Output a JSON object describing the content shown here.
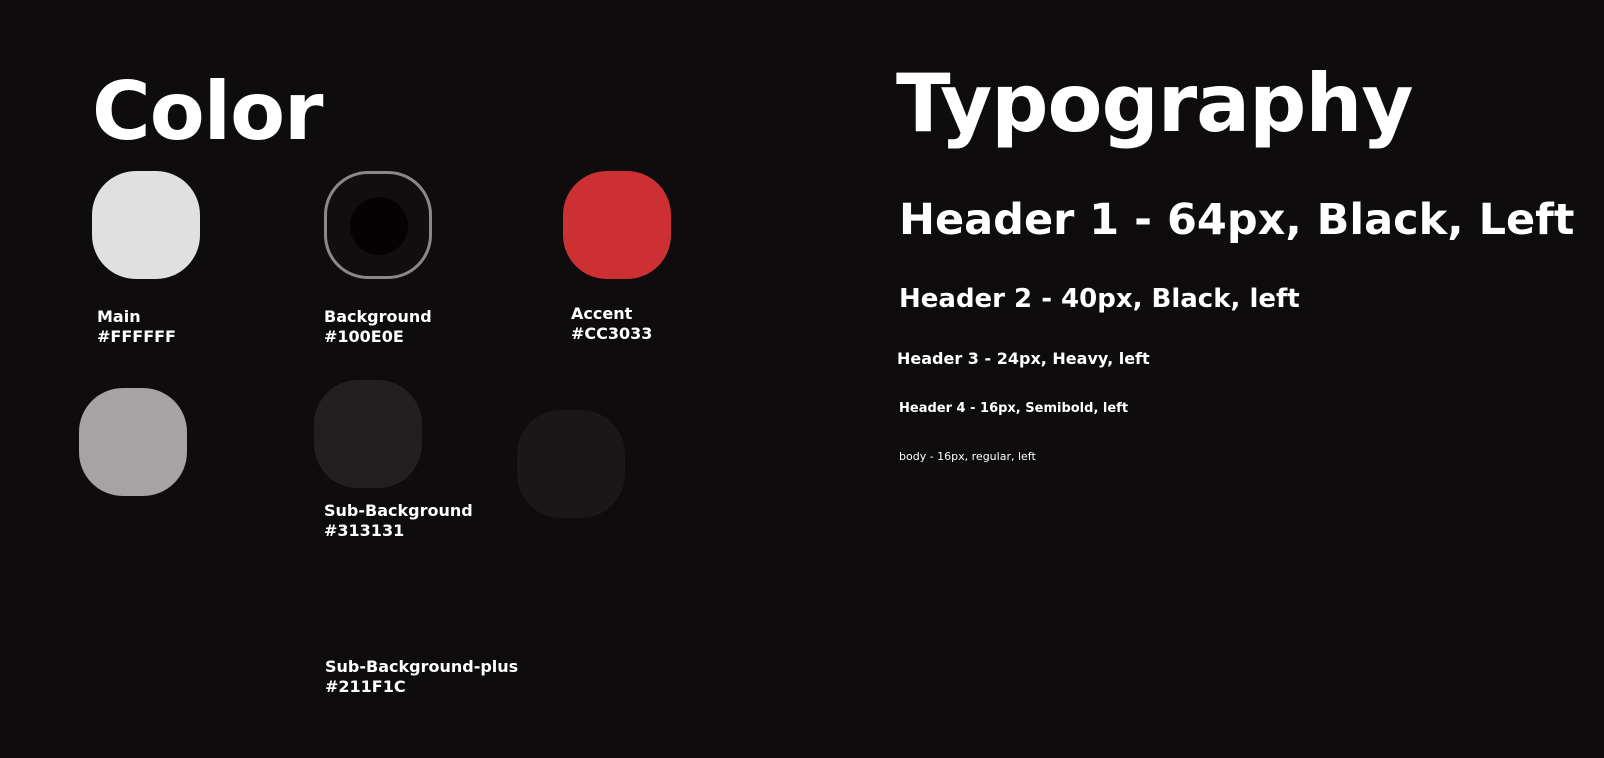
{
  "color_section": {
    "title": "Color",
    "swatches": [
      {
        "name": "Main",
        "hex": "#FFFFFF",
        "display_color": "#E0E0E0"
      },
      {
        "name": "Background",
        "hex": "#100E0E",
        "display_color": "#100E0E",
        "ring_color": "#8A8888",
        "inner_color": "#040202"
      },
      {
        "name": "Accent",
        "hex": "#CC3033",
        "display_color": "#CC3033"
      },
      {
        "name": "",
        "hex": "",
        "display_color": "#A6A3A4"
      },
      {
        "name": "Sub-Background",
        "hex": "#313131",
        "display_color": "#221F20"
      },
      {
        "name": "Sub-Background-plus",
        "hex": "#211F1C",
        "display_color": "#1A1718"
      }
    ]
  },
  "typography_section": {
    "title": "Typography",
    "samples": {
      "h1": "Header 1 - 64px, Black, Left",
      "h2": "Header 2 - 40px, Black, left",
      "h3": "Header 3 - 24px, Heavy, left",
      "h4": "Header 4 - 16px, Semibold, left",
      "body": "body - 16px, regular, left"
    }
  },
  "colors": {
    "page_background": "#0E0C0D",
    "text": "#FFFFFF"
  }
}
